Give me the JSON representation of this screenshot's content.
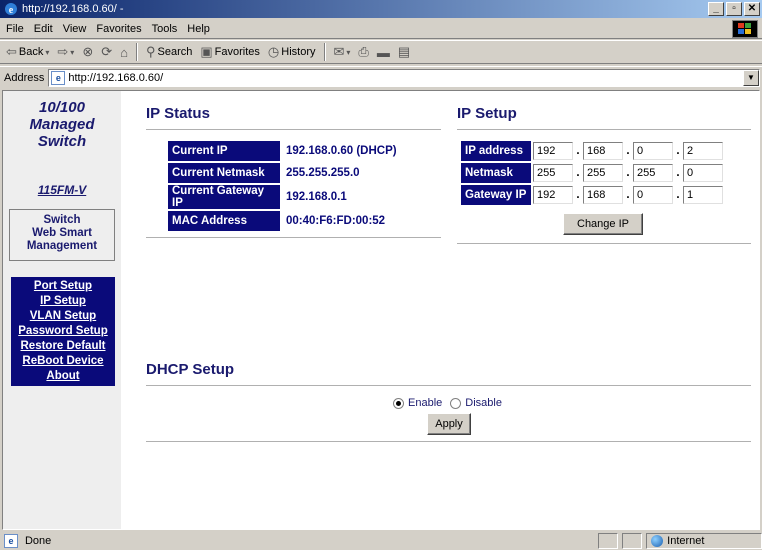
{
  "window": {
    "title": "http://192.168.0.60/ -"
  },
  "menu": [
    "File",
    "Edit",
    "View",
    "Favorites",
    "Tools",
    "Help"
  ],
  "toolbar": {
    "back": "Back",
    "search": "Search",
    "favorites": "Favorites",
    "history": "History"
  },
  "address": {
    "label": "Address",
    "url": "http://192.168.0.60/"
  },
  "sidebar": {
    "brand_line1": "10/100",
    "brand_line2": "Managed",
    "brand_line3": "Switch",
    "model": "115FM-V",
    "mgmt_line1": "Switch",
    "mgmt_line2": "Web Smart",
    "mgmt_line3": "Management",
    "nav": [
      "Port Setup",
      "IP Setup",
      "VLAN Setup",
      "Password Setup",
      "Restore Default",
      "ReBoot Device",
      "About"
    ]
  },
  "ip_status": {
    "title": "IP Status",
    "rows": [
      {
        "label": "Current IP",
        "value": "192.168.0.60 (DHCP)"
      },
      {
        "label": "Current Netmask",
        "value": "255.255.255.0"
      },
      {
        "label": "Current Gateway IP",
        "value": "192.168.0.1"
      },
      {
        "label": "MAC Address",
        "value": "00:40:F6:FD:00:52"
      }
    ]
  },
  "ip_setup": {
    "title": "IP Setup",
    "rows": [
      {
        "label": "IP address",
        "octets": [
          "192",
          "168",
          "0",
          "2"
        ]
      },
      {
        "label": "Netmask",
        "octets": [
          "255",
          "255",
          "255",
          "0"
        ]
      },
      {
        "label": "Gateway IP",
        "octets": [
          "192",
          "168",
          "0",
          "1"
        ]
      }
    ],
    "button": "Change IP"
  },
  "dhcp_setup": {
    "title": "DHCP Setup",
    "enable_label": "Enable",
    "disable_label": "Disable",
    "selected": "Enable",
    "button": "Apply"
  },
  "statusbar": {
    "status": "Done",
    "zone": "Internet"
  }
}
